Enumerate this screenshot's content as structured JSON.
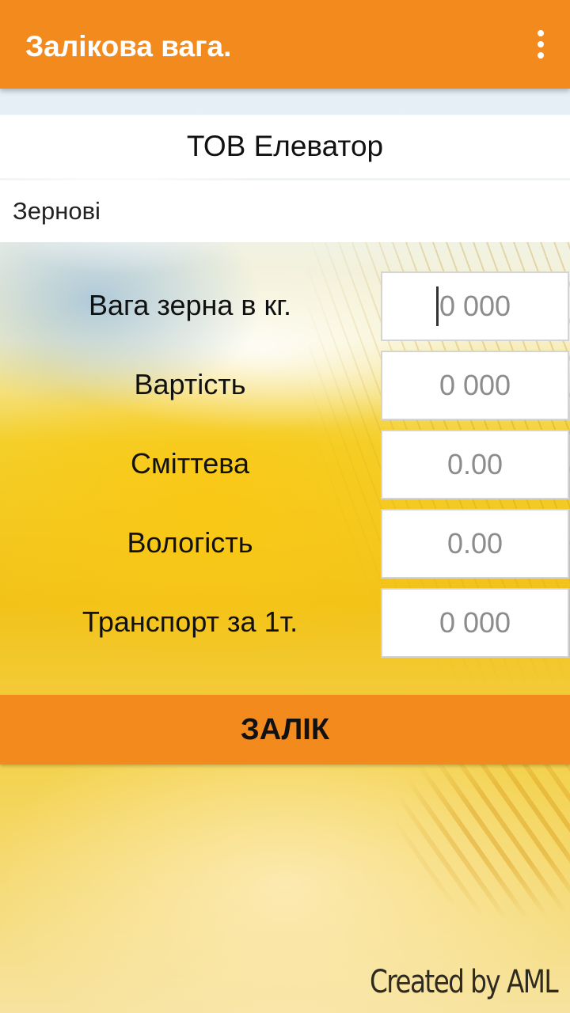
{
  "appbar": {
    "title": "Залікова вага.",
    "menu_icon": "more-vert-icon"
  },
  "company": "ТОВ Елеватор",
  "category": "Зернові",
  "fields": [
    {
      "label": "Вага зерна в кг.",
      "placeholder": "0 000"
    },
    {
      "label": "Вартість",
      "placeholder": "0 000"
    },
    {
      "label": "Сміттева",
      "placeholder": "0.00"
    },
    {
      "label": "Вологість",
      "placeholder": "0.00"
    },
    {
      "label": "Транспорт за 1т.",
      "placeholder": "0 000"
    }
  ],
  "calc_button": "ЗАЛІК",
  "credit": "Created by AML",
  "colors": {
    "accent": "#f28a1e",
    "field_bg": "#ffffff",
    "placeholder": "#8c8c8c"
  }
}
